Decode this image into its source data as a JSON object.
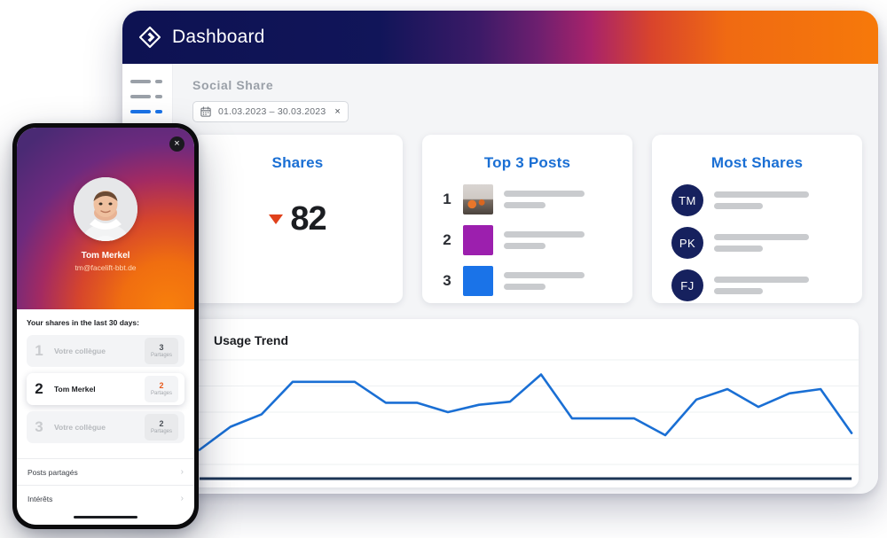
{
  "desktop": {
    "header": {
      "title": "Dashboard",
      "logo_icon": "diamond-logo-icon"
    },
    "sidebar": {
      "items": [
        {
          "name": "nav-item-1",
          "active": false
        },
        {
          "name": "nav-item-2",
          "active": false
        },
        {
          "name": "nav-item-3",
          "active": true
        },
        {
          "name": "nav-item-4",
          "active": false
        }
      ]
    },
    "section": {
      "title": "Social Share",
      "date_filter": {
        "icon": "calendar-icon",
        "value": "01.03.2023 – 30.03.2023",
        "clear_icon": "×"
      }
    },
    "cards": {
      "shares": {
        "title": "Shares",
        "value": "82",
        "trend_direction": "down",
        "trend_color": "#e0411b"
      },
      "top_posts": {
        "title": "Top 3 Posts",
        "items": [
          {
            "rank": "1",
            "thumb": "photo"
          },
          {
            "rank": "2",
            "thumb": "purple"
          },
          {
            "rank": "3",
            "thumb": "blue"
          }
        ]
      },
      "most_shares": {
        "title": "Most Shares",
        "items": [
          {
            "initials": "TM"
          },
          {
            "initials": "PK"
          },
          {
            "initials": "FJ"
          }
        ]
      }
    },
    "trend": {
      "title": "Usage Trend"
    }
  },
  "phone": {
    "close_icon": "×",
    "profile": {
      "name": "Tom Merkel",
      "email": "tm@facelift-bbt.de"
    },
    "list_heading": "Your shares in the last 30 days:",
    "rows": [
      {
        "rank": "1",
        "name": "Votre collègue",
        "count": "3",
        "label": "Partages",
        "active": false
      },
      {
        "rank": "2",
        "name": "Tom Merkel",
        "count": "2",
        "label": "Partages",
        "active": true
      },
      {
        "rank": "3",
        "name": "Votre collègue",
        "count": "2",
        "label": "Partages",
        "active": false
      }
    ],
    "menu": [
      {
        "label": "Posts partagés",
        "chevron": "›"
      },
      {
        "label": "Intérêts",
        "chevron": "›"
      }
    ]
  },
  "chart_data": {
    "type": "line",
    "title": "Usage Trend",
    "xlabel": "",
    "ylabel": "",
    "grid": true,
    "legend": null,
    "line_color": "#1a6fd4",
    "axis_color": "#1c3556",
    "ylim": [
      0,
      100
    ],
    "x": [
      0,
      1,
      2,
      3,
      4,
      5,
      6,
      7,
      8,
      9,
      10,
      11,
      12,
      13,
      14,
      15,
      16,
      17,
      18,
      19
    ],
    "values": [
      14,
      36,
      48,
      79,
      79,
      79,
      59,
      59,
      50,
      57,
      60,
      86,
      44,
      44,
      44,
      28,
      62,
      72,
      55,
      68,
      72,
      30
    ]
  }
}
